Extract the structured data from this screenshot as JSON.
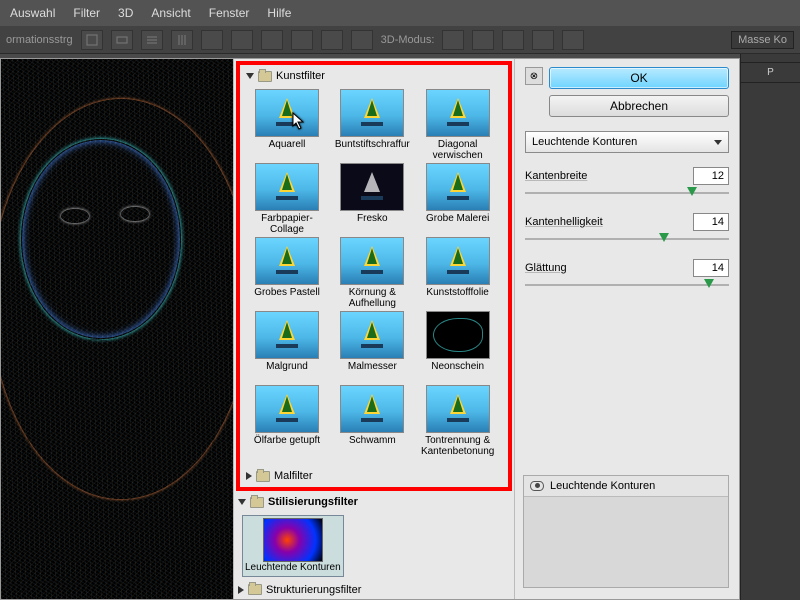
{
  "menubar": {
    "items": [
      "Auswahl",
      "Filter",
      "3D",
      "Ansicht",
      "Fenster",
      "Hilfe"
    ]
  },
  "toolbar": {
    "left_label": "ormationsstrg",
    "mode_label": "3D-Modus:",
    "right_panel": "Masse Ko"
  },
  "categories": {
    "kunstfilter": {
      "label": "Kunstfilter",
      "thumbs": [
        {
          "label": "Aquarell"
        },
        {
          "label": "Buntstiftschraffur"
        },
        {
          "label": "Diagonal verwischen"
        },
        {
          "label": "Farbpapier-Collage"
        },
        {
          "label": "Fresko"
        },
        {
          "label": "Grobe Malerei"
        },
        {
          "label": "Grobes Pastell"
        },
        {
          "label": "Körnung & Aufhellung"
        },
        {
          "label": "Kunststofffolie"
        },
        {
          "label": "Malgrund"
        },
        {
          "label": "Malmesser"
        },
        {
          "label": "Neonschein"
        },
        {
          "label": "Ölfarbe getupft"
        },
        {
          "label": "Schwamm"
        },
        {
          "label": "Tontrennung & Kantenbetonung"
        }
      ]
    },
    "malfilter": {
      "label": "Malfilter"
    },
    "stilisierung": {
      "label": "Stilisierungsfilter",
      "selected_thumb": "Leuchtende Konturen"
    },
    "strukturierung": {
      "label": "Strukturierungsfilter"
    }
  },
  "controls": {
    "ok": "OK",
    "cancel": "Abbrechen",
    "collapse": "☆",
    "filter_dropdown": "Leuchtende Konturen",
    "sliders": [
      {
        "label": "Kantenbreite",
        "value": "12",
        "pos": 82
      },
      {
        "label": "Kantenhelligkeit",
        "value": "14",
        "pos": 68
      },
      {
        "label": "Glättung",
        "value": "14",
        "pos": 90
      }
    ]
  },
  "layers": {
    "active": "Leuchtende Konturen"
  },
  "side_tabs": [
    "",
    "P"
  ]
}
